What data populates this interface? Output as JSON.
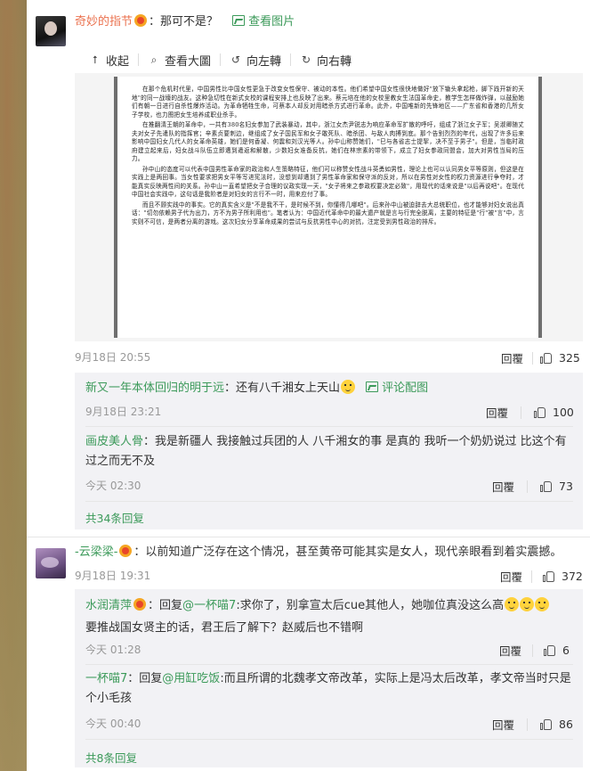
{
  "comment1": {
    "username": "奇妙的指节",
    "text": "：那可不是？",
    "view_image": "查看图片",
    "toolbar": {
      "collapse": "收起",
      "view_large": "查看大圖",
      "rotate_left": "向左轉",
      "rotate_right": "向右轉"
    },
    "image_paragraphs": [
      "在那个危机时代里，中国男性比中国女性更急于改变女性保守、被动的本性。他们希望中国女性很快地做好\"放下锄头拿起枪，脚下践开新的天地\"的同一战壕的战友。这种急切性在新式女校的课程安排上也反映了出来。蔡元培在他的女校里教女生法国革命史，教学生怎样做炸弹，以鼓励她们有朝一日进行自杀性爆炸活动。为革命牺牲生命，可蔡本人却反对用暗杀方式进行革命。此外，中国唯新的先锋地区——广东省和香港的几所女子学校，也力图把女生培养成职业杀手。",
      "在推翻清王朝的革命中，一共有380名妇女参加了武装暴动，其中，浙江女杰尹锐志为响应革命军扩散的呼吁，组成了浙江女子军；吴淑卿随丈夫对女子先遣队的指挥官；辛素贞要刺边，继组成了女子国民军和女子敢死队、暗杀团、与敌人肉搏到底。那个告别烈烈的年代，出现了许多后来影响中国妇女几代人的女革命英雄，她们是何香凝、何震和刘汉光等人。孙中山称赞她们，\"巳与各省志士提挈，决不至于男子\"。但是，当临时政府建立起来后，妇女战斗队伍立即遭到遣返和解散，少数妇女准备反抗，她们在林宗素的带领下，成立了妇女参政同盟会，加大对男性当局的压力。",
      "孙中山的态度可以代表中国男性革命家的政治和人生策略特征，他们可以称赞女性战斗英勇如男性，理论上也可以认同男女平等原则，但这是在实践上是两回事。当女性要求把男女平等写进宪法时，没想到却遭到了男性革命家和保守派的反对，所以在男性对女性的权力资源进行争夺时，才能真实反映两性间的关系。孙中山一直希望把女子合理的议政实现一天，\"女子将来之参政权要决定必致\"，用现代的话来说是\"以后再说吧\"。在现代中国社会实践中，这句话是我阶者是对妇女的言行不一时，用来应付了事。",
      "而且不顾实践中的事实。它的真实含义是\"不是我不干，是时候不到，你懂得几哪吧\"。后来孙中山被迫辞去大总统职位，也才能够对妇女说出真话：\"切勿依赖男子代为出力，方不为男子所利用也\"。笔者认为：中国近代革命中的最大遗产就是言与行完全脱离，主要的特征是\"行\"被\"言\"中，言实则不可信，是两者分离的游戏。这次妇女分享革命成果的尝试与反抗男性中心的对抗，注定受到男性政治的排斥。"
    ],
    "date": "9月18日 20:55",
    "reply": "回覆",
    "likes": "325"
  },
  "replies1": [
    {
      "username": "新又一年本体回归的明于远",
      "text": "：还有八千湘女上天山",
      "extra": "评论配图",
      "date": "9月18日 23:21",
      "reply": "回覆",
      "likes": "100"
    },
    {
      "username": "画皮美人骨",
      "text": "：我是新疆人 我接触过兵团的人 八千湘女的事 是真的 我听一个奶奶说过 比这个有过之而无不及",
      "date": "今天 02:30",
      "reply": "回覆",
      "likes": "73"
    }
  ],
  "more1": "共34条回复",
  "comment2": {
    "username": "-云梁梁-",
    "text": "：以前知道广泛存在这个情况，甚至黄帝可能其实是女人，现代亲眼看到着实震撼。",
    "date": "9月18日 19:31",
    "reply": "回覆",
    "likes": "372"
  },
  "replies2": [
    {
      "username": "水润清萍",
      "prefix": "：回复",
      "mention": "@一杯喵7",
      "text": ":求你了，别拿宣太后cue其他人，她咖位真没这么高",
      "text2": "要推战国女贤主的话，君王后了解下？赵威后也不错啊",
      "date": "今天 01:28",
      "reply": "回覆",
      "likes": "6"
    },
    {
      "username": "一杯喵7",
      "prefix": "：回复",
      "mention": "@用缸吃饭",
      "text": ":而且所谓的北魏孝文帝改革，实际上是冯太后改革，孝文帝当时只是个小毛孩",
      "date": "今天 00:40",
      "reply": "回覆",
      "likes": "86"
    }
  ],
  "more2": "共8条回复"
}
